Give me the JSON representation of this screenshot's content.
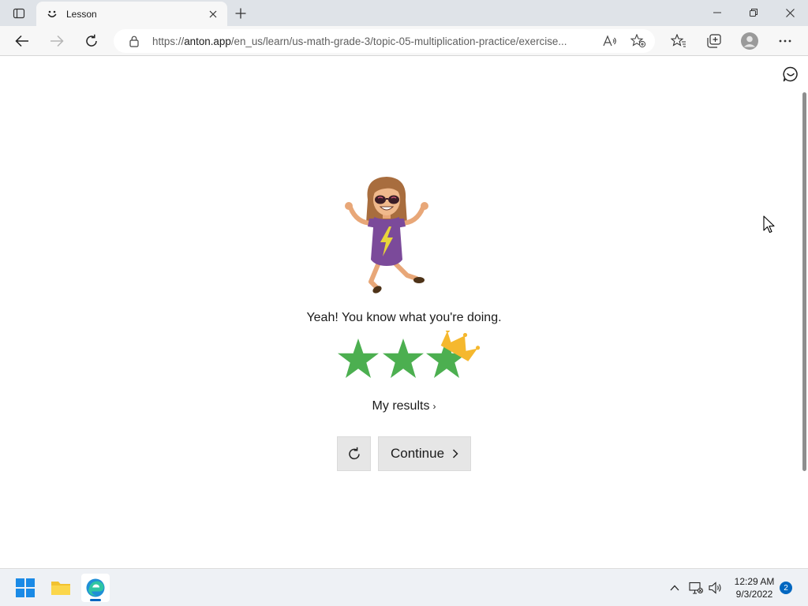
{
  "browser": {
    "tab_title": "Lesson",
    "url_scheme": "https://",
    "url_host": "anton.app",
    "url_path": "/en_us/learn/us-math-grade-3/topic-05-multiplication-practice/exercise..."
  },
  "page": {
    "message": "Yeah! You know what you're doing.",
    "stars_earned": 3,
    "stars_total": 3,
    "crown": true,
    "results_link": "My results",
    "results_chevron": "›",
    "continue_label": "Continue"
  },
  "colors": {
    "star_green": "#4caf50",
    "crown_gold": "#f5b82e",
    "shirt_purple": "#7b4a9a"
  },
  "taskbar": {
    "time": "12:29 AM",
    "date": "9/3/2022",
    "notification_count": "2"
  }
}
